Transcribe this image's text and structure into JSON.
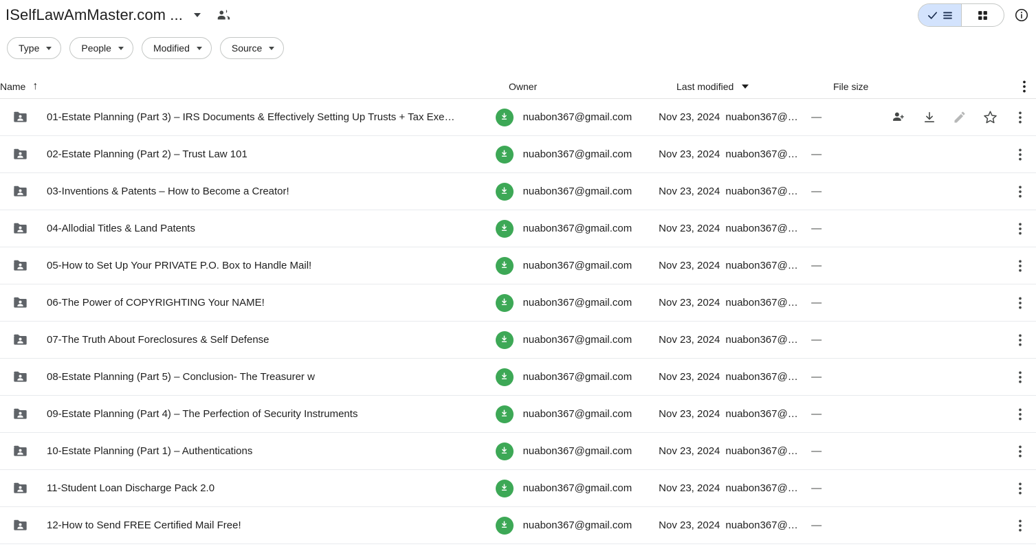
{
  "header": {
    "title": "ISelfLawAmMaster.com ...",
    "title_dropdown_icon": "chevron-down-icon",
    "shared_icon": "people-icon",
    "view_toggle": {
      "list_label_icon": "list-view-icon",
      "check_icon": "check-icon",
      "grid_label_icon": "grid-view-icon",
      "selected": "list",
      "active_bg": "#d3e3fd"
    },
    "info_icon": "info-circle-icon"
  },
  "filters": [
    {
      "label": "Type"
    },
    {
      "label": "People"
    },
    {
      "label": "Modified"
    },
    {
      "label": "Source"
    }
  ],
  "table": {
    "columns": {
      "name": "Name",
      "owner": "Owner",
      "modified": "Last modified",
      "size": "File size"
    },
    "sort": {
      "column": "Name",
      "direction": "ascending",
      "arrow": "↑"
    },
    "header_menu_icon": "more-vert-icon",
    "row_actions": [
      {
        "name": "share-icon",
        "disabled": false
      },
      {
        "name": "download-icon",
        "disabled": false
      },
      {
        "name": "edit-pencil-icon",
        "disabled": true
      },
      {
        "name": "star-icon",
        "disabled": false
      },
      {
        "name": "more-vert-icon",
        "disabled": false
      }
    ],
    "rows": [
      {
        "name": "01-Estate Planning (Part 3) – IRS Documents & Effectively Setting Up Trusts + Tax Exe…",
        "owner": "nuabon367@gmail.com",
        "modified_date": "Nov 23, 2024",
        "modified_by": "nuabon367@…",
        "size": "—",
        "icon": "shared-folder-icon",
        "hovered": true
      },
      {
        "name": "02-Estate Planning (Part 2) – Trust Law 101",
        "owner": "nuabon367@gmail.com",
        "modified_date": "Nov 23, 2024",
        "modified_by": "nuabon367@…",
        "size": "—",
        "icon": "shared-folder-icon",
        "hovered": false
      },
      {
        "name": "03-Inventions & Patents – How to Become a Creator!",
        "owner": "nuabon367@gmail.com",
        "modified_date": "Nov 23, 2024",
        "modified_by": "nuabon367@…",
        "size": "—",
        "icon": "shared-folder-icon",
        "hovered": false
      },
      {
        "name": "04-Allodial Titles & Land Patents",
        "owner": "nuabon367@gmail.com",
        "modified_date": "Nov 23, 2024",
        "modified_by": "nuabon367@…",
        "size": "—",
        "icon": "shared-folder-icon",
        "hovered": false
      },
      {
        "name": "05-How to Set Up Your PRIVATE P.O. Box to Handle Mail!",
        "owner": "nuabon367@gmail.com",
        "modified_date": "Nov 23, 2024",
        "modified_by": "nuabon367@…",
        "size": "—",
        "icon": "shared-folder-icon",
        "hovered": false
      },
      {
        "name": "06-The Power of COPYRIGHTING Your NAME!",
        "owner": "nuabon367@gmail.com",
        "modified_date": "Nov 23, 2024",
        "modified_by": "nuabon367@…",
        "size": "—",
        "icon": "shared-folder-icon",
        "hovered": false
      },
      {
        "name": "07-The Truth About Foreclosures & Self Defense",
        "owner": "nuabon367@gmail.com",
        "modified_date": "Nov 23, 2024",
        "modified_by": "nuabon367@…",
        "size": "—",
        "icon": "shared-folder-icon",
        "hovered": false
      },
      {
        "name": "08-Estate Planning (Part 5) – Conclusion- The Treasurer w",
        "owner": "nuabon367@gmail.com",
        "modified_date": "Nov 23, 2024",
        "modified_by": "nuabon367@…",
        "size": "—",
        "icon": "shared-folder-icon",
        "hovered": false
      },
      {
        "name": "09-Estate Planning (Part 4) – The Perfection of Security Instruments",
        "owner": "nuabon367@gmail.com",
        "modified_date": "Nov 23, 2024",
        "modified_by": "nuabon367@…",
        "size": "—",
        "icon": "shared-folder-icon",
        "hovered": false
      },
      {
        "name": "10-Estate Planning (Part 1) – Authentications",
        "owner": "nuabon367@gmail.com",
        "modified_date": "Nov 23, 2024",
        "modified_by": "nuabon367@…",
        "size": "—",
        "icon": "shared-folder-icon",
        "hovered": false
      },
      {
        "name": "11-Student Loan Discharge Pack 2.0",
        "owner": "nuabon367@gmail.com",
        "modified_date": "Nov 23, 2024",
        "modified_by": "nuabon367@…",
        "size": "—",
        "icon": "shared-folder-icon",
        "hovered": false
      },
      {
        "name": "12-How to Send FREE Certified Mail Free!",
        "owner": "nuabon367@gmail.com",
        "modified_date": "Nov 23, 2024",
        "modified_by": "nuabon367@…",
        "size": "—",
        "icon": "shared-folder-icon",
        "hovered": false
      }
    ]
  },
  "colors": {
    "accent_selected": "#d3e3fd",
    "avatar_green": "#3da856",
    "folder_grey": "#5f6368",
    "text_primary": "#1f1f1f",
    "divider": "#e8eaed"
  }
}
